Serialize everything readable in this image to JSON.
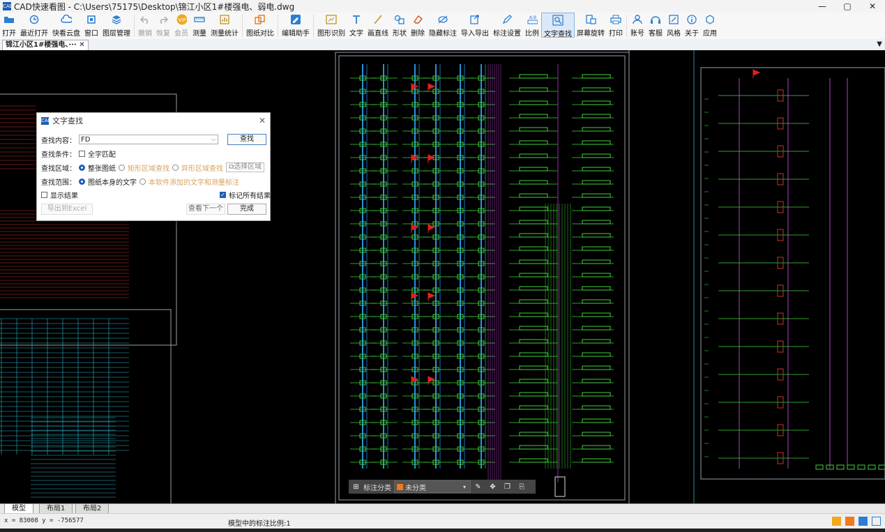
{
  "window": {
    "app_icon_text": "CAD",
    "title": "CAD快速看图 - C:\\Users\\75175\\Desktop\\锦江小区1#楼强电、弱电.dwg",
    "minimize": "—",
    "maximize": "▢",
    "close": "✕"
  },
  "toolbar": {
    "items": [
      {
        "label": "打开",
        "icon": "folder-open-icon"
      },
      {
        "label": "最近打开",
        "icon": "recent-clock-icon"
      },
      {
        "label": "快看云盘",
        "icon": "cloud-icon"
      },
      {
        "label": "窗口",
        "icon": "window-icon"
      },
      {
        "label": "图层管理",
        "icon": "layers-icon"
      },
      {
        "label": "撤销",
        "icon": "undo-icon",
        "disabled": true
      },
      {
        "label": "恢复",
        "icon": "redo-icon",
        "disabled": true
      },
      {
        "label": "会员",
        "icon": "vip-badge-icon",
        "disabled": true
      },
      {
        "label": "测量",
        "icon": "ruler-icon"
      },
      {
        "label": "测量统计",
        "icon": "measure-stats-icon"
      },
      {
        "label": "图纸对比",
        "icon": "compare-icon"
      },
      {
        "label": "编辑助手",
        "icon": "edit-assistant-icon"
      },
      {
        "label": "图形识别",
        "icon": "shape-recognition-icon"
      },
      {
        "label": "文字",
        "icon": "text-icon"
      },
      {
        "label": "画直线",
        "icon": "line-icon"
      },
      {
        "label": "形状",
        "icon": "shape-icon"
      },
      {
        "label": "删除",
        "icon": "eraser-icon"
      },
      {
        "label": "隐藏标注",
        "icon": "hide-annotation-icon"
      },
      {
        "label": "导入导出",
        "icon": "import-export-icon"
      },
      {
        "label": "标注设置",
        "icon": "annotation-settings-icon"
      },
      {
        "label": "比例",
        "icon": "scale-icon"
      },
      {
        "label": "文字查找",
        "icon": "text-search-icon",
        "active": true
      },
      {
        "label": "屏幕旋转",
        "icon": "screen-rotate-icon"
      },
      {
        "label": "打印",
        "icon": "printer-icon"
      },
      {
        "label": "账号",
        "icon": "account-icon"
      },
      {
        "label": "客服",
        "icon": "headset-icon"
      },
      {
        "label": "风格",
        "icon": "style-icon"
      },
      {
        "label": "关于",
        "icon": "info-icon"
      },
      {
        "label": "应用",
        "icon": "apps-icon"
      }
    ],
    "vip_text": "VIP",
    "ratio_text": "A:B"
  },
  "tabs": {
    "doc_tab": "锦江小区1#楼强电、··· ✕",
    "menu_glyph": "▼"
  },
  "dialog": {
    "icon_text": "CAD",
    "title": "文字查找",
    "close_glyph": "✕",
    "search_label": "查找内容：",
    "search_value": "FD",
    "find_button": "查找",
    "condition_label": "查找条件：",
    "full_match": "全字匹配",
    "area_label": "查找区域：",
    "area_whole": "整张图纸",
    "area_rect": "矩形区域查找",
    "area_irregular": "异形区域查找",
    "area_select": "选择区域",
    "scope_label": "查找范围：",
    "scope_drawing": "图纸本身的文字",
    "scope_added": "本软件添加的文字和测量标注",
    "show_results": "显示结果",
    "mark_all": "标记所有结果",
    "mark_all_checked": true,
    "export_excel": "导出到Excel",
    "find_next": "查看下一个",
    "done": "完成"
  },
  "float_bar": {
    "label": "标注分类",
    "category": "未分类",
    "category_color": "#f07a1d"
  },
  "layouts": [
    "模型",
    "布局1",
    "布局2"
  ],
  "status": {
    "coords": "x = 83008  y = -756577",
    "scale": "模型中的标注比例:1"
  }
}
